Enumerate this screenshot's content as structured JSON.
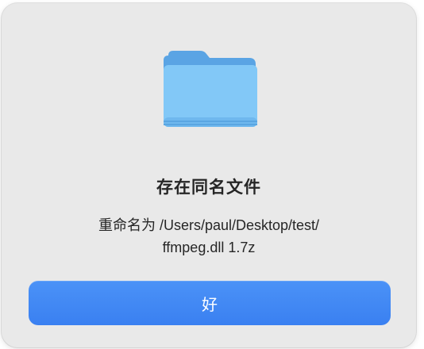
{
  "dialog": {
    "icon": "folder-icon",
    "title": "存在同名文件",
    "message_line1": "重命名为 /Users/paul/Desktop/test/",
    "message_line2": "ffmpeg.dll 1.7z",
    "ok_label": "好"
  },
  "colors": {
    "dialog_background": "#e9e9e9",
    "accent_button": "#3d86f3",
    "folder_blue": "#79c3f5"
  }
}
